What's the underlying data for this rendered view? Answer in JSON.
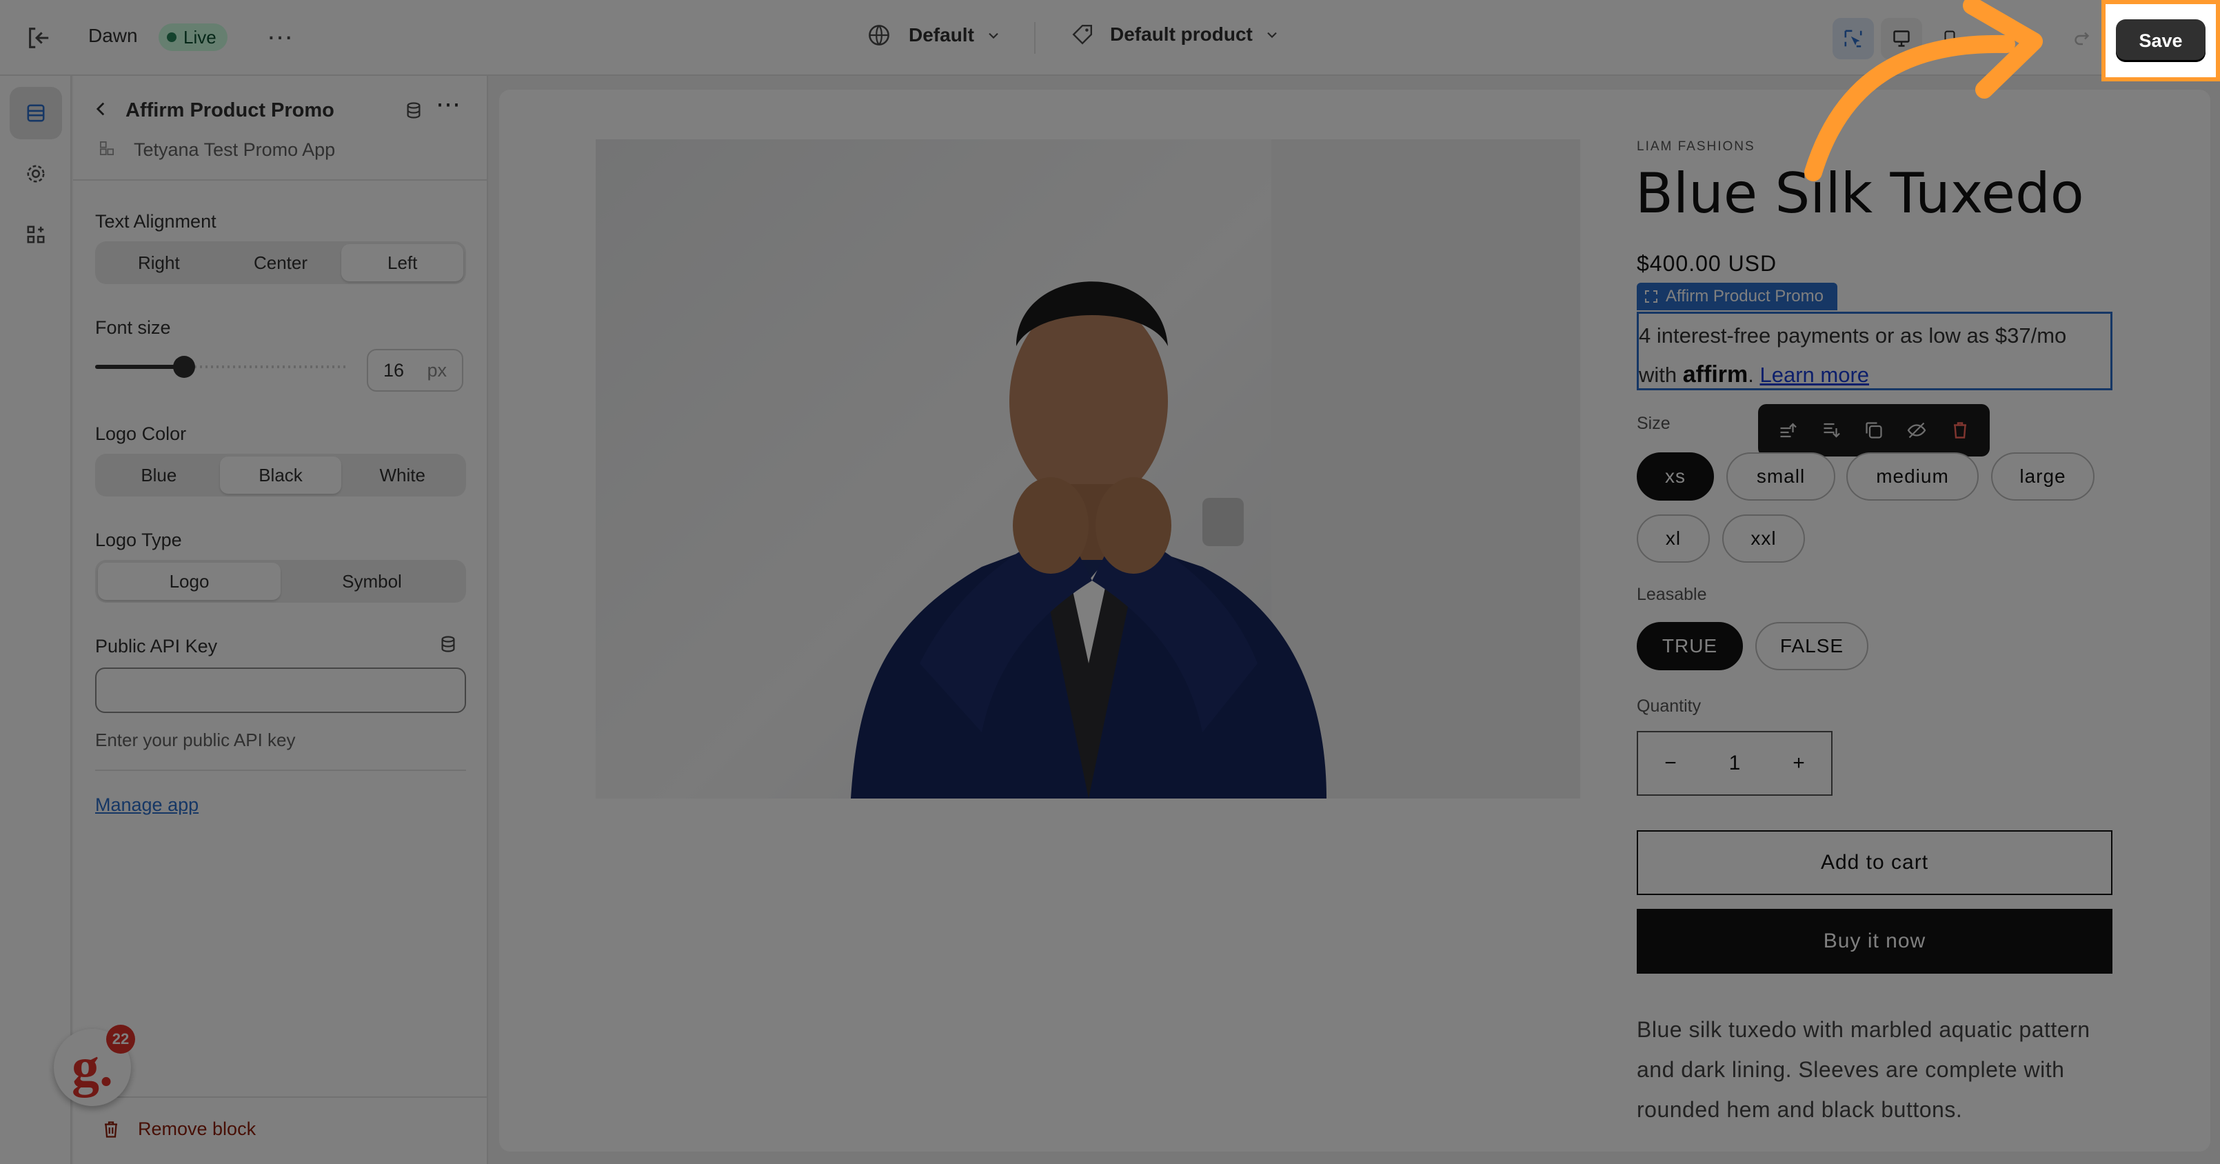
{
  "topbar": {
    "theme_name": "Dawn",
    "live_badge": "Live",
    "more": "…",
    "template_selector": "Default",
    "product_selector": "Default product",
    "save_label": "Save"
  },
  "panel": {
    "title": "Affirm Product Promo",
    "subtitle": "Tetyana Test Promo App",
    "text_alignment": {
      "label": "Text Alignment",
      "options": [
        "Right",
        "Center",
        "Left"
      ],
      "selected": "Left"
    },
    "font_size": {
      "label": "Font size",
      "value": "16",
      "unit": "px",
      "slider_fraction": 0.35
    },
    "logo_color": {
      "label": "Logo Color",
      "options": [
        "Blue",
        "Black",
        "White"
      ],
      "selected": "Black"
    },
    "logo_type": {
      "label": "Logo Type",
      "options": [
        "Logo",
        "Symbol"
      ],
      "selected": "Logo"
    },
    "api_key": {
      "label": "Public API Key",
      "value": "",
      "placeholder": "",
      "help": "Enter your public API key"
    },
    "manage_link": "Manage app",
    "remove_block": "Remove block",
    "notification_count": "22"
  },
  "product": {
    "vendor": "LIAM FASHIONS",
    "title": "Blue Silk Tuxedo",
    "price": "$400.00 USD",
    "promo_tag": "Affirm Product Promo",
    "promo_line1": "4 interest-free payments or as low as $37/mo",
    "promo_with": "with",
    "affirm_logo": "affirm",
    "promo_period": ".",
    "learn_more": "Learn more",
    "size_label": "Size",
    "sizes": [
      "xs",
      "small",
      "medium",
      "large",
      "xl",
      "xxl"
    ],
    "size_selected": "xs",
    "leasable_label": "Leasable",
    "leasable_options": [
      "TRUE",
      "FALSE"
    ],
    "leasable_selected": "TRUE",
    "quantity_label": "Quantity",
    "quantity_minus": "−",
    "quantity_value": "1",
    "quantity_plus": "+",
    "add_to_cart": "Add to cart",
    "buy_now": "Buy it now",
    "description": [
      "Blue silk tuxedo with marbled aquatic pattern",
      "and dark lining. Sleeves are complete with",
      "rounded hem and black buttons."
    ]
  },
  "colors": {
    "highlight": "#ff9a2e",
    "accent_blue": "#2c6ecb",
    "live_green": "#1a7f37"
  }
}
